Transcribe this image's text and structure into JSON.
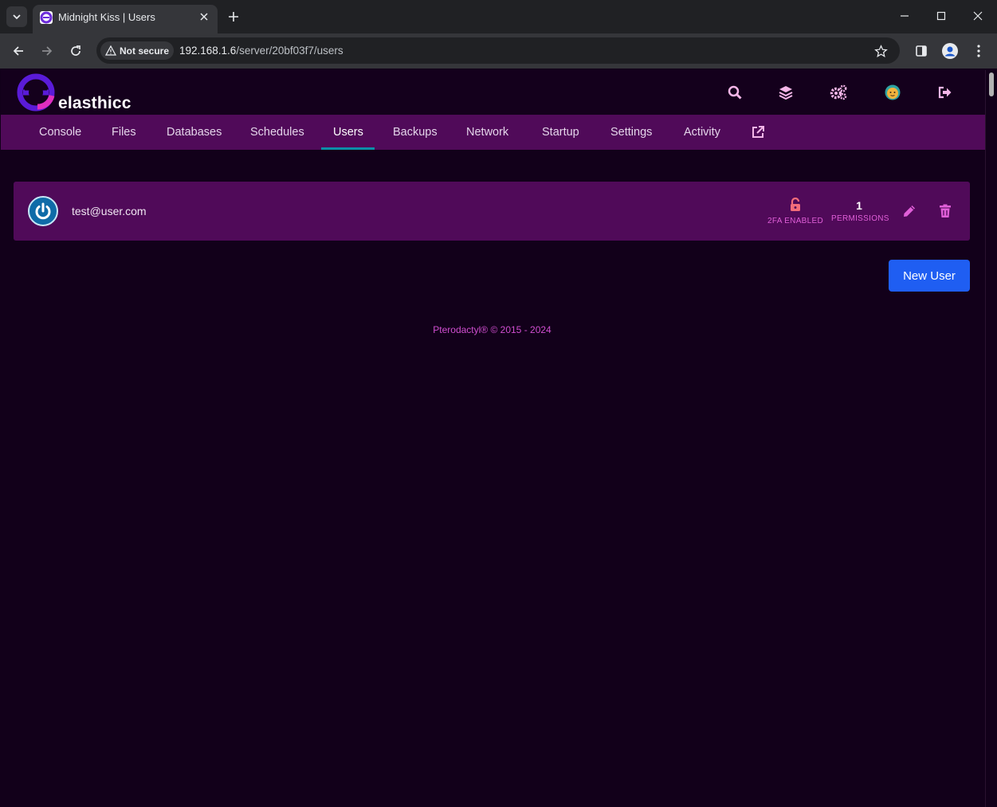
{
  "browser": {
    "tab_title": "Midnight Kiss | Users",
    "security_label": "Not secure",
    "url_host": "192.168.1.6",
    "url_path": "/server/20bf03f7/users"
  },
  "app": {
    "brand": "elasthicc",
    "header_icons": [
      "search-icon",
      "layers-icon",
      "cogs-icon",
      "avatar-icon",
      "sign-out-icon"
    ]
  },
  "nav": {
    "items": [
      {
        "label": "Console"
      },
      {
        "label": "Files"
      },
      {
        "label": "Databases"
      },
      {
        "label": "Schedules"
      },
      {
        "label": "Users"
      },
      {
        "label": "Backups"
      },
      {
        "label": "Network"
      },
      {
        "label": "Startup"
      },
      {
        "label": "Settings"
      },
      {
        "label": "Activity"
      }
    ],
    "active": "Users"
  },
  "users": [
    {
      "email": "test@user.com",
      "tfa_label": "2FA ENABLED",
      "permissions_count": "1",
      "permissions_label": "PERMISSIONS"
    }
  ],
  "actions": {
    "new_user_label": "New User"
  },
  "footer": {
    "text": "Pterodactyl® © 2015 - 2024"
  },
  "colors": {
    "background": "#12001a",
    "nav_bar": "#500a59",
    "accent_pink": "#e05fd8",
    "primary_button": "#1f5ef2",
    "active_underline": "#0c8fa8"
  }
}
